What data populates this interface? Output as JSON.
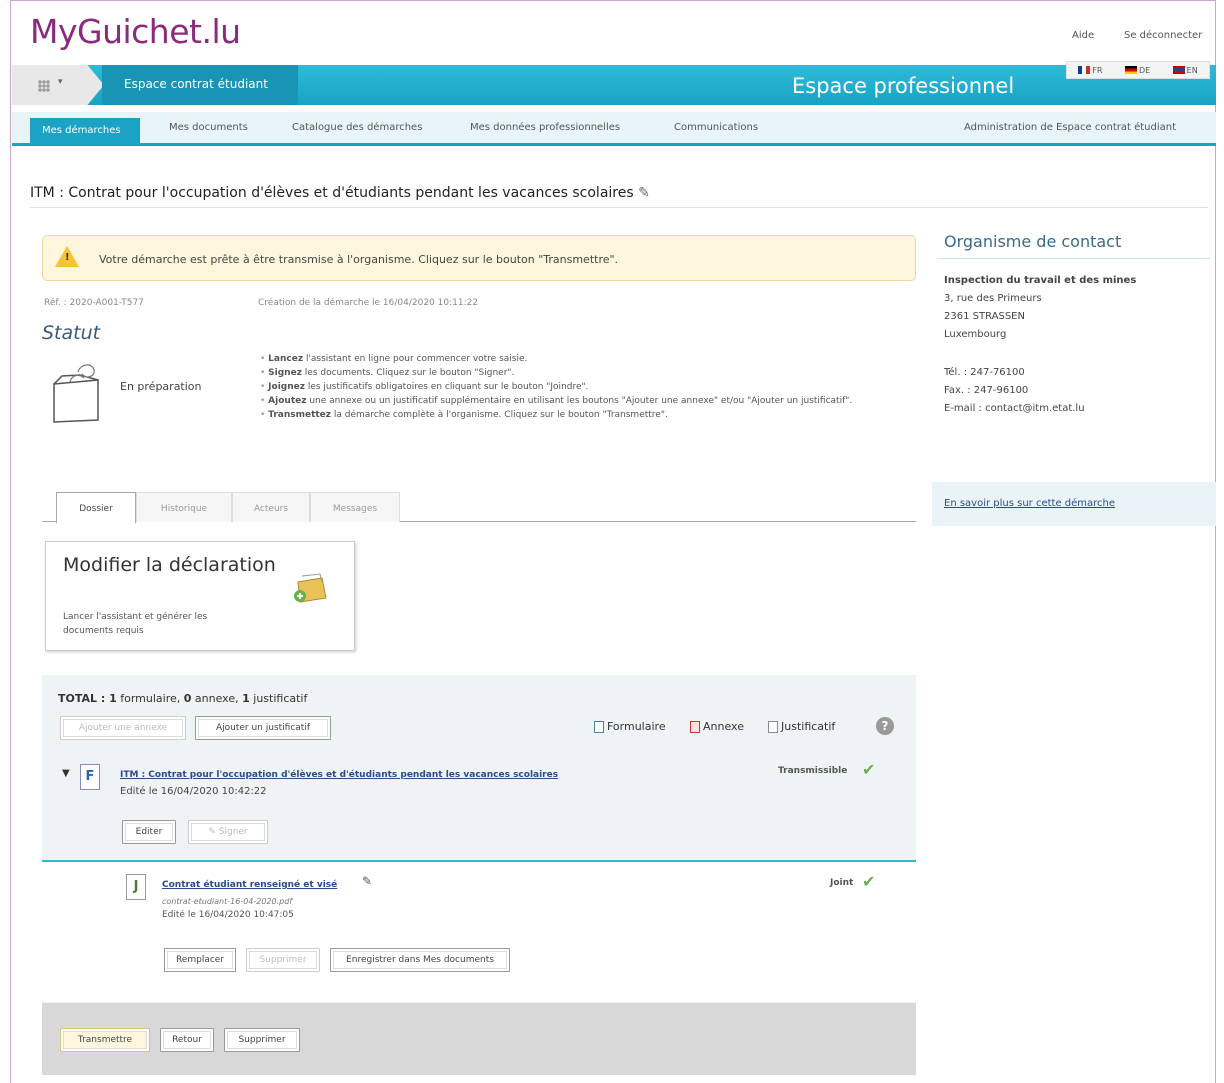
{
  "header": {
    "logo": "MyGuichet.lu",
    "help": "Aide",
    "logout": "Se déconnecter",
    "space_label": "Espace contrat étudiant",
    "space_type": "Espace professionnel",
    "languages": [
      "FR",
      "DE",
      "EN"
    ]
  },
  "nav": {
    "items": [
      "Mes démarches",
      "Mes documents",
      "Catalogue des démarches",
      "Mes données professionnelles",
      "Communications"
    ],
    "admin": "Administration de Espace contrat étudiant"
  },
  "page": {
    "title": "ITM : Contrat pour l'occupation d'élèves et d'étudiants pendant les vacances scolaires",
    "alert": "Votre démarche est prête à être transmise à l'organisme. Cliquez sur le bouton \"Transmettre\".",
    "ref": "Réf. : 2020-A001-T577",
    "created": "Création de la démarche le 16/04/2020 10:11:22",
    "statut_heading": "Statut",
    "status": "En préparation",
    "steps": [
      {
        "bold": "Lancez",
        "text": " l'assistant en ligne pour commencer votre saisie."
      },
      {
        "bold": "Signez",
        "text": " les documents. Cliquez sur le bouton \"Signer\"."
      },
      {
        "bold": "Joignez",
        "text": " les justificatifs obligatoires en cliquant sur le bouton \"Joindre\"."
      },
      {
        "bold": "Ajoutez",
        "text": " une annexe ou un justificatif supplémentaire en utilisant les boutons \"Ajouter une annexe\" et/ou \"Ajouter un justificatif\"."
      },
      {
        "bold": "Transmettez",
        "text": " la démarche complète à l'organisme. Cliquez sur le bouton \"Transmettre\"."
      }
    ]
  },
  "tabs": [
    "Dossier",
    "Historique",
    "Acteurs",
    "Messages"
  ],
  "card": {
    "title": "Modifier la déclaration",
    "desc": "Lancer l'assistant et générer les documents requis"
  },
  "dossier": {
    "total_prefix": "TOTAL : ",
    "total_forms": "1",
    "forms_label": " formulaire, ",
    "total_annexes": "0",
    "annexes_label": " annexe, ",
    "total_justif": "1",
    "justif_label": " justificatif",
    "add_annex": "Ajouter une annexe",
    "add_justif": "Ajouter un justificatif",
    "legend_form": "Formulaire",
    "legend_annex": "Annexe",
    "legend_justif": "Justificatif",
    "form_title": "ITM : Contrat pour l'occupation d'élèves et d'étudiants pendant les vacances scolaires",
    "form_edited": "Edité le 16/04/2020 10:42:22",
    "form_status": "Transmissible",
    "edit": "Editer",
    "sign": "Signer",
    "attach_title": "Contrat étudiant renseigné et visé",
    "attach_file": "contrat-etudiant-16-04-2020.pdf",
    "attach_edited": "Edité le 16/04/2020 10:47:05",
    "attach_status": "Joint",
    "replace": "Remplacer",
    "delete": "Supprimer",
    "save_docs": "Enregistrer dans Mes documents"
  },
  "footer_buttons": {
    "submit": "Transmettre",
    "back": "Retour",
    "delete": "Supprimer"
  },
  "sidebar": {
    "heading": "Organisme de contact",
    "org": "Inspection du travail et des mines",
    "addr1": "3, rue des Primeurs",
    "addr2": "2361 STRASSEN",
    "addr3": "Luxembourg",
    "tel": "Tél. : 247-76100",
    "fax": "Fax. : 247-96100",
    "email": "E-mail : contact@itm.etat.lu",
    "more_link": "En savoir plus sur cette démarche"
  }
}
